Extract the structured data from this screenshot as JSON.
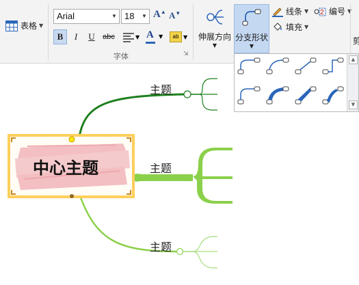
{
  "toolbar": {
    "table_label": "表格",
    "font_name": "Arial",
    "font_size": "18",
    "grow_font": "A",
    "shrink_font": "A",
    "bold": "B",
    "italic": "I",
    "underline": "U",
    "strikethrough": "abc",
    "font_color_glyph": "A",
    "highlight_glyph": "ab",
    "font_group_label": "字体",
    "stretch_direction_label": "伸展方向",
    "branch_shape_label": "分支形状",
    "line_label": "线条",
    "numbering_label": "编号",
    "fill_label": "填充",
    "cut_label_partial": "剪"
  },
  "canvas": {
    "central_topic": "中心主题",
    "topics": [
      "主题",
      "主题",
      "主题"
    ]
  },
  "colors": {
    "branch_dark": "#1e7f1e",
    "branch_light": "#8bd04a",
    "branch_pale": "#a7dd80",
    "central_border": "#ffcf5c",
    "central_fill": "#f1b5b9",
    "accent_blue": "#2a66b8"
  },
  "icons": {
    "table": "table-icon",
    "line": "pencil-line-icon",
    "numbering": "numbering-icon",
    "fill": "paint-bucket-icon",
    "stretch": "stretch-direction-icon",
    "branch_shape": "branch-shape-icon"
  }
}
